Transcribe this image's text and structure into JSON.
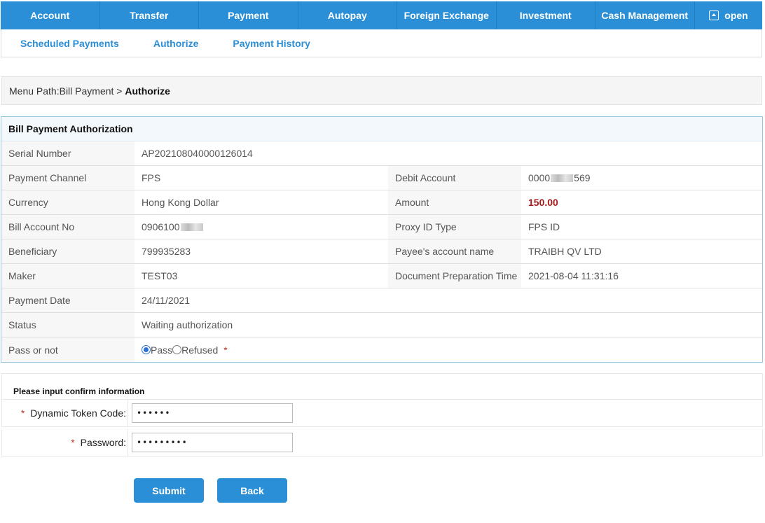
{
  "nav": {
    "items": [
      "Account",
      "Transfer",
      "Payment",
      "Autopay",
      "Foreign Exchange",
      "Investment",
      "Cash Management"
    ],
    "open_label": "open"
  },
  "subnav": {
    "items": [
      "Scheduled Payments",
      "Authorize",
      "Payment History"
    ]
  },
  "breadcrumb": {
    "prefix": "Menu Path:Bill Payment > ",
    "current": "Authorize"
  },
  "panel": {
    "title": "Bill Payment Authorization",
    "serial_label": "Serial Number",
    "serial_value": "AP202108040000126014",
    "channel_label": "Payment Channel",
    "channel_value": "FPS",
    "debit_label": "Debit Account",
    "debit_prefix": "0000",
    "debit_suffix": "569",
    "currency_label": "Currency",
    "currency_value": "Hong Kong Dollar",
    "amount_label": "Amount",
    "amount_value": "150.00",
    "bill_label": "Bill Account No",
    "bill_prefix": "0906100",
    "proxy_label": "Proxy ID Type",
    "proxy_value": "FPS ID",
    "beneficiary_label": "Beneficiary",
    "beneficiary_value": "799935283",
    "payee_label": "Payee's account name",
    "payee_value": "TRAIBH QV LTD",
    "maker_label": "Maker",
    "maker_value": "TEST03",
    "docprep_label": "Document Preparation Time",
    "docprep_value": "2021-08-04 11:31:16",
    "paydate_label": "Payment Date",
    "paydate_value": "24/11/2021",
    "status_label": "Status",
    "status_value": "Waiting authorization",
    "pass_label": "Pass or not",
    "pass_option": "Pass",
    "refused_option": "Refused",
    "required_mark": "*"
  },
  "confirm": {
    "title": "Please input confirm information",
    "required_mark": "*",
    "token_label": "Dynamic Token Code:",
    "token_value": "••••••",
    "password_label": "Password:",
    "password_value": "•••••••••"
  },
  "buttons": {
    "submit": "Submit",
    "back": "Back"
  }
}
